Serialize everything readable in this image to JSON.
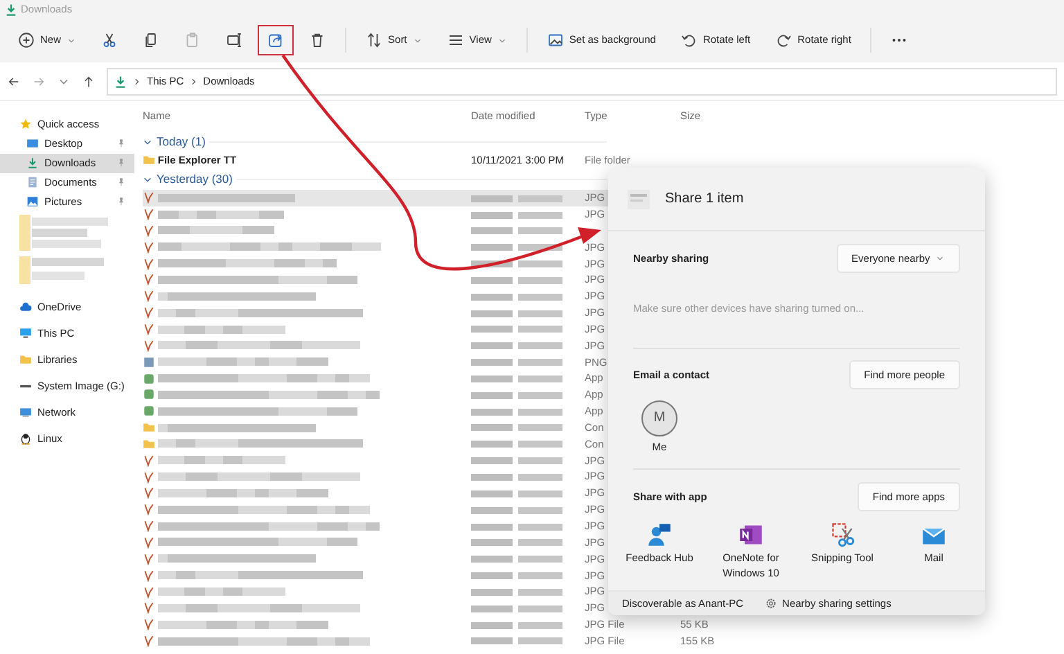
{
  "window": {
    "title": "Downloads"
  },
  "toolbar": [
    {
      "kind": "new",
      "label": "New",
      "disabled": false,
      "highlighted": false
    },
    {
      "kind": "cut",
      "disabled": false,
      "highlighted": false
    },
    {
      "kind": "copy",
      "disabled": false,
      "highlighted": false
    },
    {
      "kind": "paste",
      "disabled": true,
      "highlighted": false
    },
    {
      "kind": "rename",
      "disabled": false,
      "highlighted": false
    },
    {
      "kind": "share",
      "disabled": false,
      "highlighted": true
    },
    {
      "kind": "delete",
      "disabled": false,
      "highlighted": false
    },
    {
      "kind": "sep"
    },
    {
      "kind": "sort",
      "label": "Sort",
      "disabled": false,
      "highlighted": false
    },
    {
      "kind": "view",
      "label": "View",
      "disabled": false,
      "highlighted": false
    },
    {
      "kind": "sep"
    },
    {
      "kind": "background",
      "label": "Set as background",
      "disabled": false,
      "highlighted": false
    },
    {
      "kind": "rotleft",
      "label": "Rotate left",
      "disabled": false,
      "highlighted": false
    },
    {
      "kind": "rotright",
      "label": "Rotate right",
      "disabled": false,
      "highlighted": false
    },
    {
      "kind": "sep"
    },
    {
      "kind": "more",
      "disabled": false,
      "highlighted": false
    }
  ],
  "address": {
    "crumbs": [
      "This PC",
      "Downloads"
    ]
  },
  "sidebar": {
    "items": [
      {
        "kind": "star",
        "label": "Quick access",
        "pinned": false,
        "selected": false
      },
      {
        "kind": "desktop",
        "label": "Desktop",
        "pinned": true,
        "selected": false
      },
      {
        "kind": "download",
        "label": "Downloads",
        "pinned": true,
        "selected": true
      },
      {
        "kind": "doc",
        "label": "Documents",
        "pinned": true,
        "selected": false
      },
      {
        "kind": "pics",
        "label": "Pictures",
        "pinned": true,
        "selected": false
      },
      {
        "kind": "blurred"
      },
      {
        "kind": "cloud",
        "label": "OneDrive",
        "pinned": false,
        "selected": false
      },
      {
        "kind": "pc",
        "label": "This PC",
        "pinned": false,
        "selected": false
      },
      {
        "kind": "lib",
        "label": "Libraries",
        "pinned": false,
        "selected": false
      },
      {
        "kind": "drive",
        "label": "System Image (G:)",
        "pinned": false,
        "selected": false
      },
      {
        "kind": "net",
        "label": "Network",
        "pinned": false,
        "selected": false
      },
      {
        "kind": "linux",
        "label": "Linux",
        "pinned": false,
        "selected": false
      }
    ]
  },
  "table": {
    "columns": [
      "Name",
      "Date modified",
      "Type",
      "Size"
    ],
    "groups": [
      {
        "label": "Today (1)",
        "rows": [
          {
            "kind": "folder",
            "name": "File Explorer TT",
            "date": "10/11/2021 3:00 PM",
            "type": "File folder",
            "selected": false
          }
        ]
      },
      {
        "label": "Yesterday (30)",
        "rows": [
          {
            "kind": "jpg",
            "type": "JPG",
            "selected": true
          },
          {
            "kind": "jpg",
            "type": "JPG",
            "selected": false
          },
          {
            "kind": "jpg",
            "selected": false
          },
          {
            "kind": "jpg",
            "type": "JPG",
            "selected": false
          },
          {
            "kind": "jpg",
            "type": "JPG",
            "selected": false
          },
          {
            "kind": "jpg",
            "type": "JPG",
            "selected": false
          },
          {
            "kind": "jpg",
            "type": "JPG",
            "selected": false
          },
          {
            "kind": "jpg",
            "type": "JPG",
            "selected": false
          },
          {
            "kind": "jpg",
            "type": "JPG",
            "selected": false
          },
          {
            "kind": "jpg",
            "type": "JPG",
            "selected": false
          },
          {
            "kind": "png",
            "type": "PNG",
            "selected": false
          },
          {
            "kind": "app",
            "type": "App",
            "selected": false
          },
          {
            "kind": "app",
            "type": "App",
            "selected": false
          },
          {
            "kind": "app",
            "type": "App",
            "selected": false
          },
          {
            "kind": "folder",
            "type": "Con",
            "selected": false
          },
          {
            "kind": "folder",
            "type": "Con",
            "selected": false
          },
          {
            "kind": "jpg",
            "type": "JPG",
            "selected": false
          },
          {
            "kind": "jpg",
            "type": "JPG",
            "selected": false
          },
          {
            "kind": "jpg",
            "type": "JPG",
            "selected": false
          },
          {
            "kind": "jpg",
            "type": "JPG",
            "selected": false
          },
          {
            "kind": "jpg",
            "type": "JPG",
            "selected": false
          },
          {
            "kind": "jpg",
            "type": "JPG",
            "selected": false
          },
          {
            "kind": "jpg",
            "type": "JPG",
            "selected": false
          },
          {
            "kind": "jpg",
            "type": "JPG",
            "selected": false
          },
          {
            "kind": "jpg",
            "type": "JPG",
            "selected": false
          },
          {
            "kind": "jpg",
            "type": "JPG",
            "selected": false
          },
          {
            "kind": "jpg",
            "type": "JPG File",
            "size": "55 KB",
            "selected": false
          },
          {
            "kind": "jpg",
            "type": "JPG File",
            "size": "155 KB",
            "selected": false
          }
        ]
      }
    ]
  },
  "share": {
    "title": "Share 1 item",
    "nearby": {
      "label": "Nearby sharing",
      "value": "Everyone nearby",
      "hint": "Make sure other devices have sharing turned on..."
    },
    "email": {
      "label": "Email a contact",
      "button": "Find more people",
      "contacts": [
        {
          "initial": "M",
          "name": "Me"
        }
      ]
    },
    "apps": {
      "label": "Share with app",
      "button": "Find more apps",
      "items": [
        {
          "kind": "feedback",
          "name": "Feedback Hub"
        },
        {
          "kind": "onenote",
          "name": "OneNote for Windows 10"
        },
        {
          "kind": "snip",
          "name": "Snipping Tool"
        },
        {
          "kind": "mail",
          "name": "Mail"
        }
      ]
    },
    "footer": {
      "status": "Discoverable as Anant-PC",
      "settings": "Nearby sharing settings"
    }
  }
}
